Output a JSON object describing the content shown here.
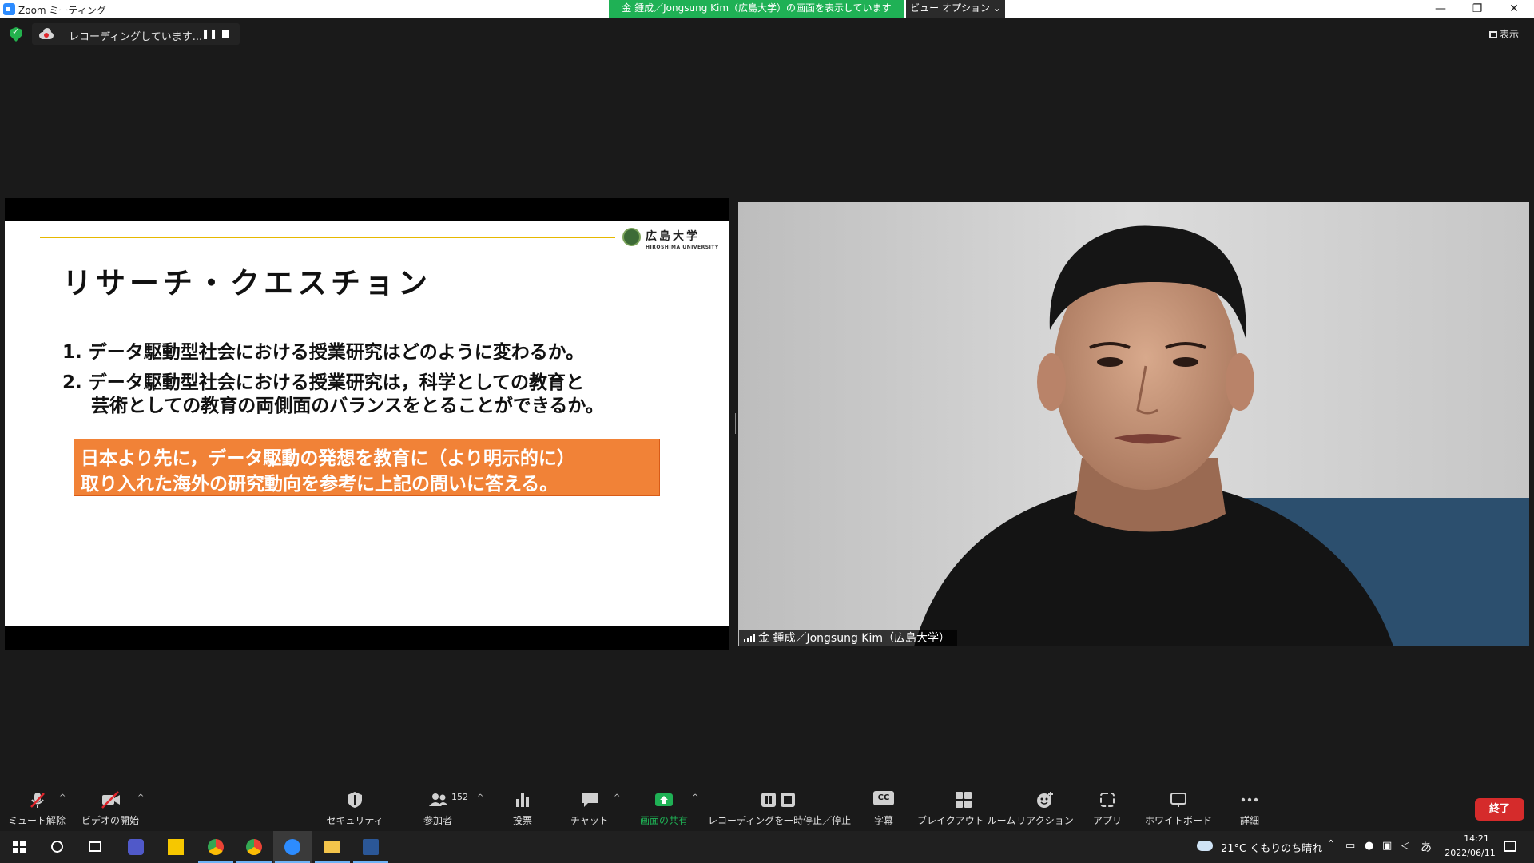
{
  "window": {
    "title": "Zoom ミーティング",
    "share_banner": "金 鍾成／Jongsung Kim（広島大学）の画面を表示しています",
    "view_options": "ビュー オプション ⌄",
    "controls": {
      "minimize": "—",
      "restore": "❐",
      "close": "✕"
    }
  },
  "recording": {
    "status": "レコーディングしています...",
    "pause": "❚❚"
  },
  "view_toggle": {
    "label": "表示"
  },
  "slide": {
    "logo_jp": "広島大学",
    "logo_en": "HIROSHIMA UNIVERSITY",
    "title": "リサーチ・クエスチョン",
    "question_1": "1. データ駆動型社会における授業研究はどのように変わるか。",
    "question_2_line1": "2. データ駆動型社会における授業研究は，科学としての教育と",
    "question_2_line2": "芸術としての教育の両側面のバランスをとることができるか。",
    "box_line1": "日本より先に，データ駆動の発想を教育に（より明示的に）",
    "box_line2": "取り入れた海外の研究動向を参考に上記の問いに答える。"
  },
  "video": {
    "participant_name": "金 鍾成／Jongsung Kim（広島大学）"
  },
  "toolbar": {
    "mute": "ミュート解除",
    "video": "ビデオの開始",
    "security": "セキュリティ",
    "participants": "参加者",
    "participants_count": "152",
    "poll": "投票",
    "chat": "チャット",
    "share": "画面の共有",
    "recording": "レコーディングを一時停止／停止",
    "captions": "字幕",
    "captions_icon_text": "CC",
    "breakout": "ブレイクアウト ルーム",
    "reactions": "リアクション",
    "apps": "アプリ",
    "whiteboard": "ホワイトボード",
    "more": "詳細",
    "end": "終了",
    "caret": "^"
  },
  "taskbar": {
    "weather": "21°C くもりのち晴れ",
    "ime": "あ",
    "time": "14:21",
    "date": "2022/06/11"
  },
  "colors": {
    "zoom_blue": "#2d8cff",
    "share_green": "#1fb155",
    "end_red": "#d52b2b",
    "slide_orange": "#f18237",
    "slide_gold": "#e6b800"
  }
}
